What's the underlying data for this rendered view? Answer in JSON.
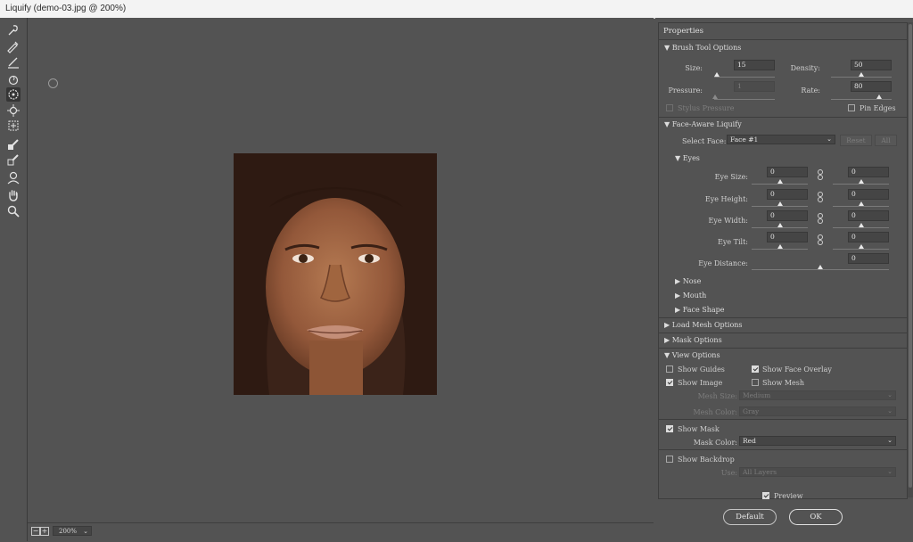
{
  "window": {
    "title": "Liquify (demo-03.jpg @ 200%)"
  },
  "tools": [
    {
      "name": "forward-warp-tool-icon"
    },
    {
      "name": "reconstruct-tool-icon"
    },
    {
      "name": "smooth-tool-icon"
    },
    {
      "name": "twirl-clockwise-tool-icon"
    },
    {
      "name": "pucker-tool-icon"
    },
    {
      "name": "bloat-tool-icon"
    },
    {
      "name": "push-left-tool-icon"
    },
    {
      "name": "freeze-mask-tool-icon"
    },
    {
      "name": "thaw-mask-tool-icon"
    },
    {
      "name": "face-tool-icon"
    },
    {
      "name": "hand-tool-icon"
    },
    {
      "name": "zoom-tool-icon"
    }
  ],
  "zoom": {
    "value": "200%",
    "minus": "−",
    "plus": "+"
  },
  "properties": {
    "title": "Properties",
    "brush_tool_options": {
      "header": "Brush Tool Options",
      "size_label": "Size:",
      "size_value": "15",
      "size_level": 0.05,
      "density_label": "Density:",
      "density_value": "50",
      "density_level": 0.5,
      "pressure_label": "Pressure:",
      "pressure_value": "1",
      "pressure_level": 0.01,
      "rate_label": "Rate:",
      "rate_value": "80",
      "rate_level": 0.8,
      "stylus_pressure_label": "Stylus Pressure",
      "stylus_pressure_checked": false,
      "pin_edges_label": "Pin Edges",
      "pin_edges_checked": false
    },
    "face_aware": {
      "header": "Face-Aware Liquify",
      "select_face_label": "Select Face:",
      "select_face_value": "Face #1",
      "reset_label": "Reset",
      "all_label": "All",
      "eyes_header": "Eyes",
      "eye_size_label": "Eye Size:",
      "eye_size_left": "0",
      "eye_size_right": "0",
      "eye_height_label": "Eye Height:",
      "eye_height_left": "0",
      "eye_height_right": "0",
      "eye_width_label": "Eye Width:",
      "eye_width_left": "0",
      "eye_width_right": "0",
      "eye_tilt_label": "Eye Tilt:",
      "eye_tilt_left": "0",
      "eye_tilt_right": "0",
      "eye_distance_label": "Eye Distance:",
      "eye_distance_value": "0",
      "nose_header": "Nose",
      "mouth_header": "Mouth",
      "face_shape_header": "Face Shape"
    },
    "load_mesh_header": "Load Mesh Options",
    "mask_options_header": "Mask Options",
    "view_options": {
      "header": "View Options",
      "show_guides_label": "Show Guides",
      "show_guides_checked": false,
      "show_face_overlay_label": "Show Face Overlay",
      "show_face_overlay_checked": true,
      "show_image_label": "Show Image",
      "show_image_checked": true,
      "show_mesh_label": "Show Mesh",
      "show_mesh_checked": false,
      "mesh_size_label": "Mesh Size:",
      "mesh_size_value": "Medium",
      "mesh_color_label": "Mesh Color:",
      "mesh_color_value": "Gray",
      "show_mask_label": "Show Mask",
      "show_mask_checked": true,
      "mask_color_label": "Mask Color:",
      "mask_color_value": "Red",
      "show_backdrop_label": "Show Backdrop",
      "show_backdrop_checked": false,
      "use_label": "Use:",
      "use_value": "All Layers"
    }
  },
  "footer": {
    "preview_label": "Preview",
    "preview_checked": true,
    "default_label": "Default",
    "ok_label": "OK"
  }
}
